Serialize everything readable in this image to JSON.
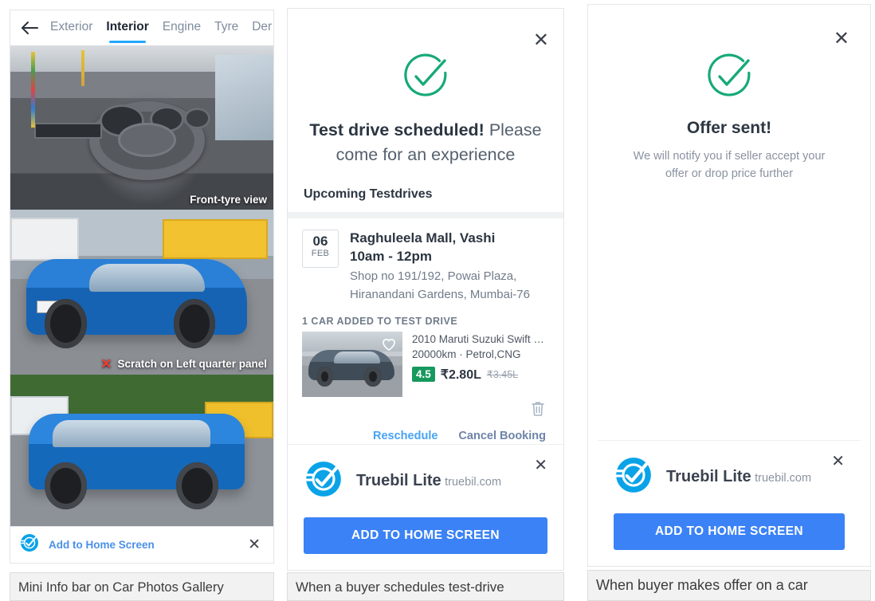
{
  "panel1": {
    "back_icon": "back-arrow-icon",
    "tabs": [
      {
        "label": "Exterior",
        "active": false
      },
      {
        "label": "Interior",
        "active": true
      },
      {
        "label": "Engine",
        "active": false
      },
      {
        "label": "Tyre",
        "active": false
      },
      {
        "label": "Der",
        "active": false
      }
    ],
    "photos": [
      {
        "caption": "Front-tyre view",
        "flag": ""
      },
      {
        "caption": "Scratch on Left quarter panel",
        "flag": "✕"
      },
      {
        "caption": "",
        "flag": ""
      }
    ],
    "mini_bar": {
      "label": "Add to Home Screen",
      "close_icon": "close-icon",
      "logo_icon": "truebil-logo-icon"
    },
    "caption": "Mini Info bar on Car Photos Gallery"
  },
  "panel2": {
    "close_icon": "close-icon",
    "success_icon": "check-circle-icon",
    "title_bold": "Test drive scheduled!",
    "title_rest": " Please come for an experience",
    "section_heading": "Upcoming Testdrives",
    "booking": {
      "day": "06",
      "month": "FEB",
      "venue": "Raghuleela Mall, Vashi",
      "time": "10am - 12pm",
      "address_line1": "Shop no 191/192, Powai Plaza,",
      "address_line2": "Hiranandani Gardens, Mumbai-76"
    },
    "cars_label": "1 CAR ADDED TO TEST DRIVE",
    "car": {
      "title": "2010 Maruti Suzuki Swift XLI...",
      "specs": "20000km · Petrol,CNG",
      "rating": "4.5",
      "price": "₹2.80L",
      "price_old": "₹3.45L",
      "favorite_icon": "heart-icon",
      "delete_icon": "trash-icon"
    },
    "actions": {
      "reschedule": "Reschedule",
      "cancel": "Cancel Booking"
    },
    "install": {
      "app_name": "Truebil Lite",
      "domain": "truebil.com",
      "button": "ADD TO HOME SCREEN",
      "close_icon": "close-icon",
      "logo_icon": "truebil-logo-icon"
    },
    "caption": "When a buyer schedules test-drive"
  },
  "panel3": {
    "close_icon": "close-icon",
    "success_icon": "check-circle-icon",
    "title": "Offer sent!",
    "subtitle": "We will notify you if seller accept your offer or drop price further",
    "install": {
      "app_name": "Truebil Lite",
      "domain": "truebil.com",
      "button": "ADD TO HOME SCREEN",
      "close_icon": "close-icon",
      "logo_icon": "truebil-logo-icon"
    },
    "caption": "When buyer makes offer on a car"
  },
  "colors": {
    "accent_blue": "#3b82f6",
    "link_blue": "#47a3f3",
    "success_green": "#17a97a",
    "rating_green": "#17995e",
    "truebil_blue": "#0aa3e8",
    "tab_underline": "#22a7ff",
    "error_red": "#f03c32"
  }
}
